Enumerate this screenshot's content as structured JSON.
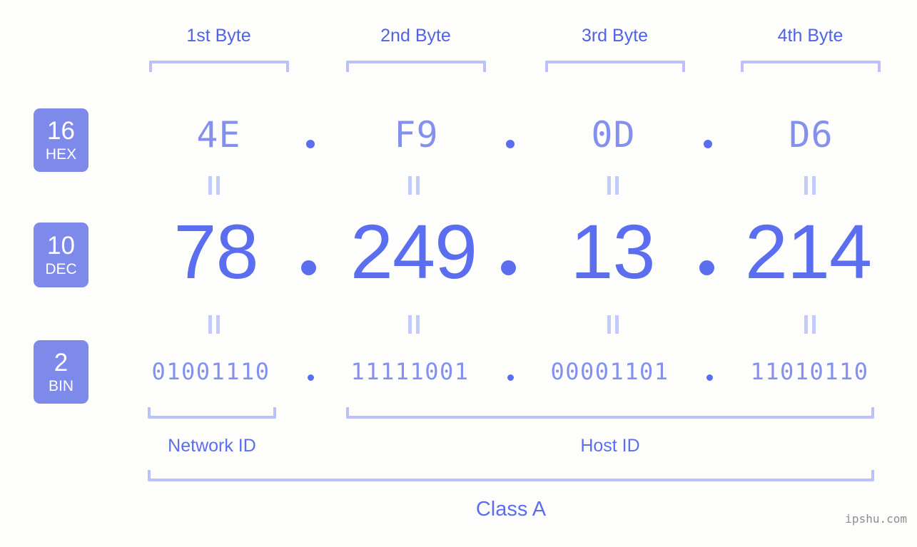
{
  "background_color": "#fdfefb",
  "accent_color": "#5b6ef0",
  "light_accent_color": "#8490ee",
  "bracket_color": "#b9c1f8",
  "badge_color": "#7e8ae9",
  "headers": [
    {
      "label": "1st Byte"
    },
    {
      "label": "2nd Byte"
    },
    {
      "label": "3rd Byte"
    },
    {
      "label": "4th Byte"
    }
  ],
  "rows": [
    {
      "base": "16",
      "base_name": "HEX",
      "values": [
        "4E",
        "F9",
        "0D",
        "D6"
      ],
      "separator": "."
    },
    {
      "base": "10",
      "base_name": "DEC",
      "values": [
        "78",
        "249",
        "13",
        "214"
      ],
      "separator": "."
    },
    {
      "base": "2",
      "base_name": "BIN",
      "values": [
        "01001110",
        "11111001",
        "00001101",
        "11010110"
      ],
      "separator": "."
    }
  ],
  "equals_symbol": "=",
  "sections": [
    {
      "label": "Network ID"
    },
    {
      "label": "Host ID"
    }
  ],
  "class_label": "Class A",
  "watermark": "ipshu.com"
}
